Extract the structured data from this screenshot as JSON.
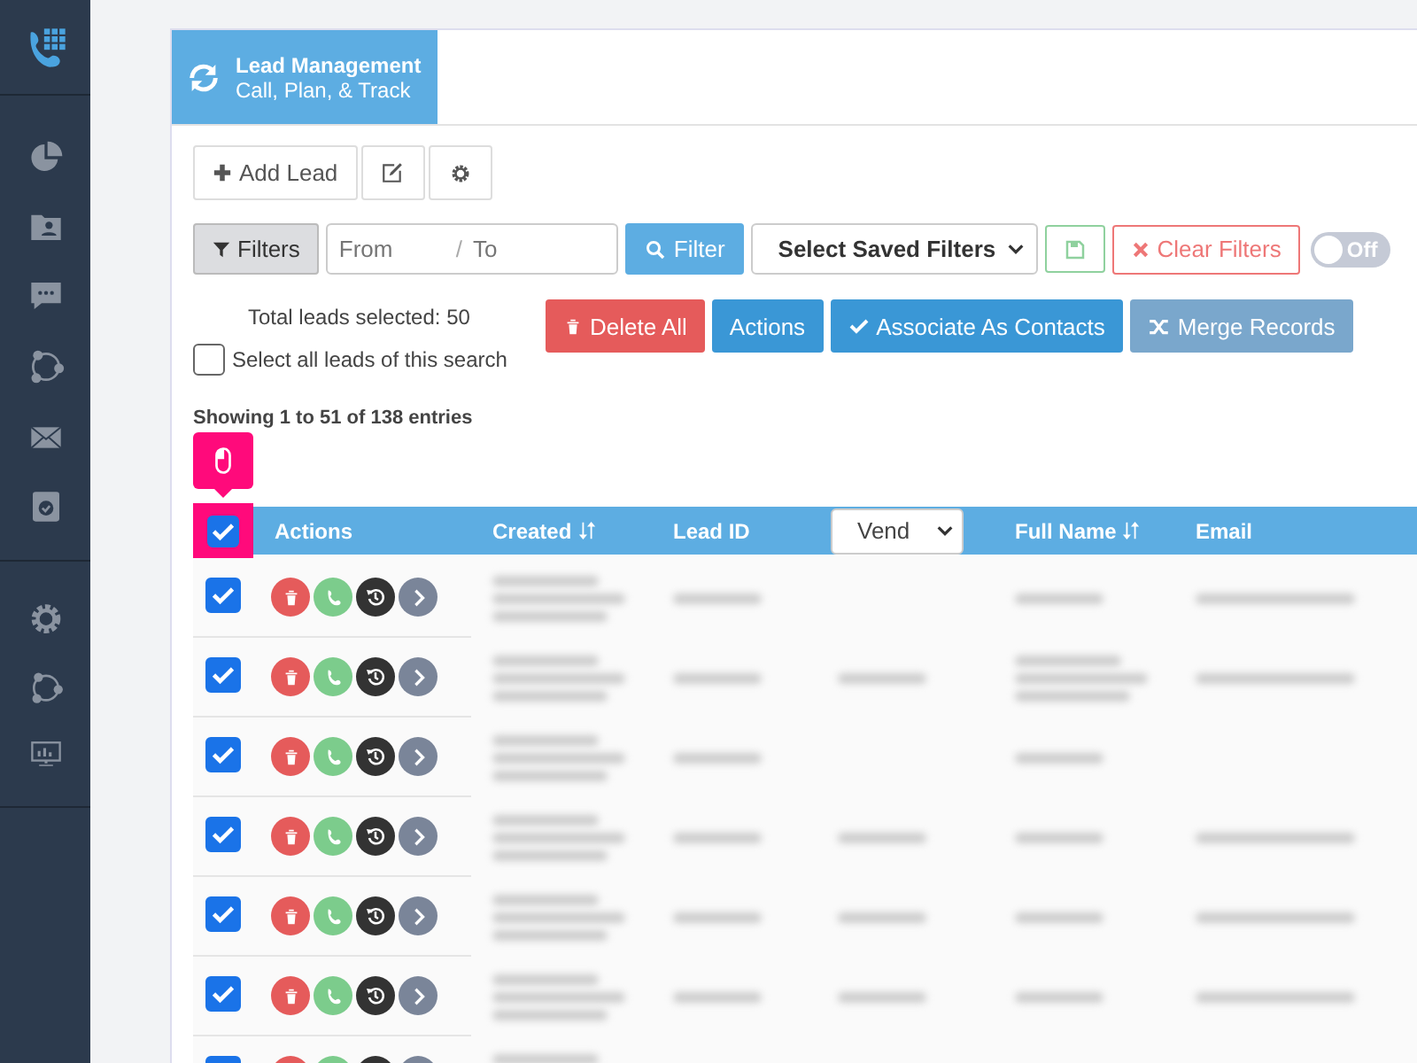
{
  "header": {
    "title": "Lead Management",
    "subtitle": "Call, Plan, & Track"
  },
  "toolbar": {
    "add_button": "Add Lead"
  },
  "filters": {
    "filters_button": "Filters",
    "date_from_placeholder": "From",
    "date_separator": "/",
    "date_to_placeholder": "To",
    "filter_button": "Filter",
    "saved_filters_select": "Select Saved Filters",
    "clear_button": "Clear Filters",
    "toggle": {
      "label": "Off",
      "on": false
    }
  },
  "selection": {
    "total": "Total leads selected: 50",
    "select_all": {
      "label": "Select all leads of this search",
      "checked": false
    }
  },
  "bulk_actions": [
    {
      "label": "Delete All",
      "kind": "delete"
    },
    {
      "label": "Actions",
      "kind": "menu"
    },
    {
      "label": "Associate As Contacts",
      "kind": "associate"
    },
    {
      "label": "Merge Records",
      "kind": "merge"
    }
  ],
  "entries_info": "Showing 1 to 51 of 138 entries",
  "table": {
    "header_checked": true,
    "columns": [
      {
        "label": "Actions",
        "kind": "text"
      },
      {
        "label": "Created",
        "kind": "sortable"
      },
      {
        "label": "Lead ID",
        "kind": "text"
      },
      {
        "label": "Vend",
        "kind": "select"
      },
      {
        "label": "Full Name",
        "kind": "sortable"
      },
      {
        "label": "Email",
        "kind": "text"
      }
    ],
    "rows": [
      {
        "checked": true,
        "cells": [
          {
            "kind": "blurred_multiline"
          },
          {
            "kind": "blurred"
          },
          {
            "kind": "empty"
          },
          {
            "kind": "blurred"
          },
          {
            "kind": "blurred"
          }
        ]
      },
      {
        "checked": true,
        "cells": [
          {
            "kind": "blurred_multiline"
          },
          {
            "kind": "blurred"
          },
          {
            "kind": "blurred"
          },
          {
            "kind": "blurred_multiline"
          },
          {
            "kind": "blurred"
          }
        ]
      },
      {
        "checked": true,
        "cells": [
          {
            "kind": "blurred_multiline"
          },
          {
            "kind": "blurred"
          },
          {
            "kind": "empty"
          },
          {
            "kind": "blurred"
          },
          {
            "kind": "empty"
          }
        ]
      },
      {
        "checked": true,
        "cells": [
          {
            "kind": "blurred_multiline"
          },
          {
            "kind": "blurred"
          },
          {
            "kind": "blurred"
          },
          {
            "kind": "blurred"
          },
          {
            "kind": "blurred"
          }
        ]
      },
      {
        "checked": true,
        "cells": [
          {
            "kind": "blurred_multiline"
          },
          {
            "kind": "blurred"
          },
          {
            "kind": "blurred"
          },
          {
            "kind": "blurred"
          },
          {
            "kind": "blurred"
          }
        ]
      },
      {
        "checked": true,
        "cells": [
          {
            "kind": "blurred_multiline"
          },
          {
            "kind": "blurred"
          },
          {
            "kind": "blurred"
          },
          {
            "kind": "blurred"
          },
          {
            "kind": "blurred"
          }
        ]
      },
      {
        "checked": true,
        "cells": [
          {
            "kind": "blurred_multiline"
          },
          {
            "kind": "empty"
          },
          {
            "kind": "empty"
          },
          {
            "kind": "empty"
          },
          {
            "kind": "empty"
          }
        ]
      }
    ]
  }
}
